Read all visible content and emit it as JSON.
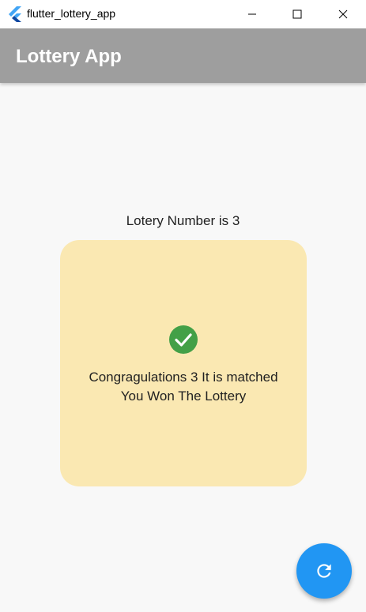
{
  "window": {
    "title": "flutter_lottery_app"
  },
  "appbar": {
    "title": "Lottery App"
  },
  "main": {
    "lottery_number_text": "Lotery Number is 3",
    "result_line1": "Congragulations 3 It is matched",
    "result_line2": "You Won The Lottery",
    "result_icon": "check-circle-icon"
  },
  "fab": {
    "icon": "refresh-icon"
  },
  "colors": {
    "appbar": "#9e9e9e",
    "card": "#fae8b2",
    "success": "#43a047",
    "fab": "#2196f3",
    "background": "#f8f8f8"
  }
}
